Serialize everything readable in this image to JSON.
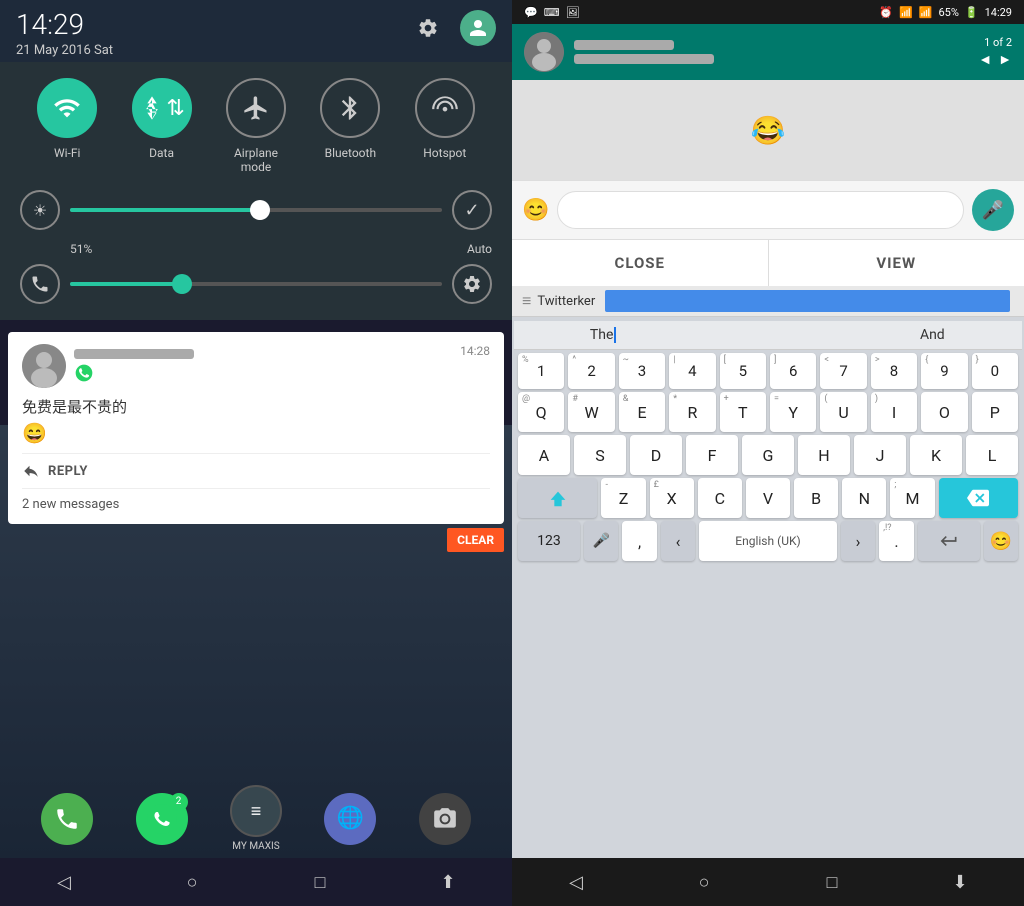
{
  "left": {
    "time": "14:29",
    "date": "21 May 2016 Sat",
    "toggles": [
      {
        "label": "Wi-Fi",
        "active": true,
        "icon": "📶"
      },
      {
        "label": "Data",
        "active": true,
        "icon": "⇅"
      },
      {
        "label": "Airplane mode",
        "active": false,
        "icon": "✈"
      },
      {
        "label": "Bluetooth",
        "active": false,
        "icon": "⚡"
      },
      {
        "label": "Hotspot",
        "active": false,
        "icon": "📡"
      }
    ],
    "brightness_pct": "51%",
    "slider_fill_brightness": "51",
    "slider_fill_volume": "30",
    "notification": {
      "name_blur": "blurred name",
      "time": "14:28",
      "message": "免费是最不贵的",
      "emoji": "😄",
      "reply_label": "REPLY",
      "count": "2 new messages"
    },
    "clear_btn": "CLEAR",
    "dock": [
      {
        "icon": "📞",
        "type": "phone",
        "label": ""
      },
      {
        "icon": "💬",
        "type": "whatsapp",
        "label": "",
        "badge": "2"
      },
      {
        "icon": "≡",
        "type": "mymaxis",
        "label": "MY MAXIS"
      },
      {
        "icon": "🌐",
        "type": "globe",
        "label": ""
      },
      {
        "icon": "📷",
        "type": "camera",
        "label": ""
      }
    ],
    "nav": [
      "◁",
      "○",
      "□",
      "⬆"
    ]
  },
  "right": {
    "status_bar": {
      "left_icons": [
        "💬",
        "⌨",
        "🖼"
      ],
      "time": "14:29",
      "battery": "65%",
      "battery_icon": "🔋"
    },
    "wa_notification": {
      "pages": "1 of 2"
    },
    "chat_emoji": "😂",
    "input_placeholder": "",
    "action_buttons": {
      "close": "CLOSE",
      "view": "VIEW"
    },
    "address_bar_text": "Twitterker",
    "keyboard": {
      "suggestions": [
        "The",
        "And"
      ],
      "numbers_row": [
        "1",
        "2",
        "3",
        "4",
        "5",
        "6",
        "7",
        "8",
        "9",
        "0"
      ],
      "numbers_sub": [
        "%",
        "^",
        "~",
        "|",
        "[",
        "]",
        "<",
        ">",
        "{",
        "}"
      ],
      "row_qwerty": [
        "Q",
        "W",
        "E",
        "R",
        "T",
        "Y",
        "U",
        "I",
        "O",
        "P"
      ],
      "row_qwerty_sub": [
        "@",
        "#",
        "&",
        "*",
        "+",
        "=",
        "("
      ],
      "row_asdf": [
        "A",
        "S",
        "D",
        "F",
        "G",
        "H",
        "J",
        "K",
        "L"
      ],
      "row_asdf_sub": [
        "",
        "",
        "",
        "",
        "",
        "",
        "",
        "",
        ""
      ],
      "row_zxcv": [
        "Z",
        "X",
        "C",
        "V",
        "B",
        "N",
        "M"
      ],
      "row_zxcv_sub": [
        "-",
        "£",
        "",
        "",
        "",
        "",
        ";"
      ],
      "bottom_row": {
        "num_label": "123",
        "mic_icon": "🎤",
        "comma": ",",
        "left_arrow": "‹",
        "space_label": "English (UK)",
        "right_arrow": "›",
        "period": ".",
        "punct": ",!?",
        "enter": "↵",
        "emoji": "😊"
      }
    },
    "nav": [
      "◁",
      "○",
      "□",
      "⬇"
    ]
  }
}
